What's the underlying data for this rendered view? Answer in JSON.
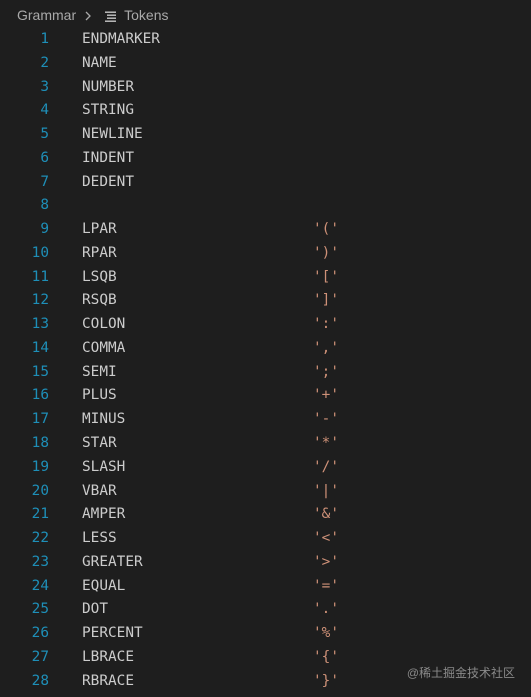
{
  "breadcrumb": {
    "parent": "Grammar",
    "file": "Tokens",
    "separator_icon": "chevron-right-icon",
    "file_icon": "text-file-lines-icon"
  },
  "editor": {
    "line_number_color": "#1e8fb8",
    "token_color": "#cccccc",
    "string_color": "#ce9178",
    "lines": [
      {
        "n": "1",
        "name": "ENDMARKER",
        "str": ""
      },
      {
        "n": "2",
        "name": "NAME",
        "str": ""
      },
      {
        "n": "3",
        "name": "NUMBER",
        "str": ""
      },
      {
        "n": "4",
        "name": "STRING",
        "str": ""
      },
      {
        "n": "5",
        "name": "NEWLINE",
        "str": ""
      },
      {
        "n": "6",
        "name": "INDENT",
        "str": ""
      },
      {
        "n": "7",
        "name": "DEDENT",
        "str": ""
      },
      {
        "n": "8",
        "name": "",
        "str": ""
      },
      {
        "n": "9",
        "name": "LPAR",
        "str": "'('"
      },
      {
        "n": "10",
        "name": "RPAR",
        "str": "')'"
      },
      {
        "n": "11",
        "name": "LSQB",
        "str": "'['"
      },
      {
        "n": "12",
        "name": "RSQB",
        "str": "']'"
      },
      {
        "n": "13",
        "name": "COLON",
        "str": "':'"
      },
      {
        "n": "14",
        "name": "COMMA",
        "str": "','"
      },
      {
        "n": "15",
        "name": "SEMI",
        "str": "';'"
      },
      {
        "n": "16",
        "name": "PLUS",
        "str": "'+'"
      },
      {
        "n": "17",
        "name": "MINUS",
        "str": "'-'"
      },
      {
        "n": "18",
        "name": "STAR",
        "str": "'*'"
      },
      {
        "n": "19",
        "name": "SLASH",
        "str": "'/'"
      },
      {
        "n": "20",
        "name": "VBAR",
        "str": "'|'"
      },
      {
        "n": "21",
        "name": "AMPER",
        "str": "'&'"
      },
      {
        "n": "22",
        "name": "LESS",
        "str": "'<'"
      },
      {
        "n": "23",
        "name": "GREATER",
        "str": "'>'"
      },
      {
        "n": "24",
        "name": "EQUAL",
        "str": "'='"
      },
      {
        "n": "25",
        "name": "DOT",
        "str": "'.'"
      },
      {
        "n": "26",
        "name": "PERCENT",
        "str": "'%'"
      },
      {
        "n": "27",
        "name": "LBRACE",
        "str": "'{'"
      },
      {
        "n": "28",
        "name": "RBRACE",
        "str": "'}'"
      }
    ]
  },
  "watermark": "@稀土掘金技术社区"
}
